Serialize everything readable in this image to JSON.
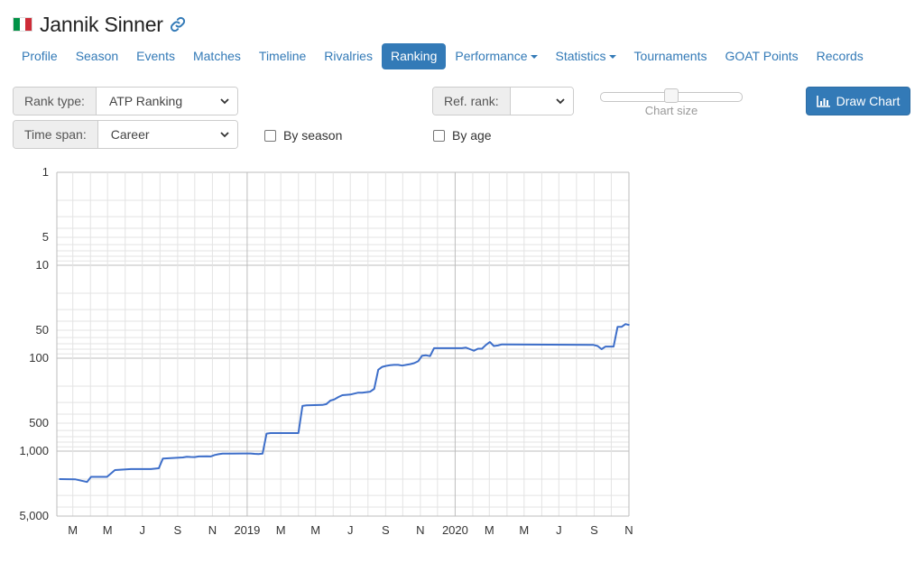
{
  "header": {
    "player_name": "Jannik Sinner",
    "flag_colors": [
      "#009246",
      "#ffffff",
      "#ce2b37"
    ],
    "link_icon": "link-icon"
  },
  "nav": {
    "items": [
      {
        "label": "Profile",
        "dropdown": false,
        "active": false
      },
      {
        "label": "Season",
        "dropdown": false,
        "active": false
      },
      {
        "label": "Events",
        "dropdown": false,
        "active": false
      },
      {
        "label": "Matches",
        "dropdown": false,
        "active": false
      },
      {
        "label": "Timeline",
        "dropdown": false,
        "active": false
      },
      {
        "label": "Rivalries",
        "dropdown": false,
        "active": false
      },
      {
        "label": "Ranking",
        "dropdown": false,
        "active": true
      },
      {
        "label": "Performance",
        "dropdown": true,
        "active": false
      },
      {
        "label": "Statistics",
        "dropdown": true,
        "active": false
      },
      {
        "label": "Tournaments",
        "dropdown": false,
        "active": false
      },
      {
        "label": "GOAT Points",
        "dropdown": false,
        "active": false
      },
      {
        "label": "Records",
        "dropdown": false,
        "active": false
      }
    ]
  },
  "controls": {
    "rank_type": {
      "label": "Rank type:",
      "value": "ATP Ranking"
    },
    "time_span": {
      "label": "Time span:",
      "value": "Career"
    },
    "ref_rank": {
      "label": "Ref. rank:",
      "value": ""
    },
    "by_season": {
      "label": "By season",
      "checked": false
    },
    "by_age": {
      "label": "By age",
      "checked": false
    },
    "chart_size": {
      "label": "Chart size",
      "value_fraction": 0.5
    },
    "draw_button": {
      "label": "Draw Chart",
      "icon": "bar-chart-icon"
    }
  },
  "colors": {
    "accent": "#337ab7",
    "series_line": "#3d6ec9",
    "grid_major": "#bdbdbd",
    "grid_minor": "#e3e3e3"
  },
  "chart_data": {
    "type": "line",
    "title": "",
    "xlabel": "",
    "ylabel": "",
    "y_scale": "log-reversed",
    "ylim": [
      1,
      5000
    ],
    "xlim": [
      "2018-02-01",
      "2020-11-01"
    ],
    "grid": true,
    "x_tick_labels": [
      "M",
      "M",
      "J",
      "S",
      "N",
      "2019",
      "M",
      "M",
      "J",
      "S",
      "N",
      "2020",
      "M",
      "M",
      "J",
      "S",
      "N"
    ],
    "y_tick_labels": [
      "1",
      "5",
      "10",
      "50",
      "100",
      "500",
      "1,000",
      "5,000"
    ],
    "y_tick_values": [
      1,
      5,
      10,
      50,
      100,
      500,
      1000,
      5000
    ],
    "series": [
      {
        "name": "",
        "points": [
          [
            "2018-02-05",
            2000
          ],
          [
            "2018-03-05",
            2010
          ],
          [
            "2018-03-26",
            2150
          ],
          [
            "2018-04-02",
            1890
          ],
          [
            "2018-04-30",
            1890
          ],
          [
            "2018-05-14",
            1600
          ],
          [
            "2018-06-11",
            1560
          ],
          [
            "2018-07-16",
            1560
          ],
          [
            "2018-07-30",
            1530
          ],
          [
            "2018-08-06",
            1200
          ],
          [
            "2018-09-10",
            1170
          ],
          [
            "2018-09-17",
            1150
          ],
          [
            "2018-09-24",
            1155
          ],
          [
            "2018-10-01",
            1160
          ],
          [
            "2018-10-08",
            1140
          ],
          [
            "2018-10-22",
            1135
          ],
          [
            "2018-10-29",
            1140
          ],
          [
            "2018-11-05",
            1100
          ],
          [
            "2018-11-12",
            1080
          ],
          [
            "2018-11-19",
            1065
          ],
          [
            "2018-12-24",
            1060
          ],
          [
            "2018-12-31",
            1060
          ],
          [
            "2019-01-07",
            1060
          ],
          [
            "2019-01-14",
            1070
          ],
          [
            "2019-01-21",
            1075
          ],
          [
            "2019-01-28",
            1065
          ],
          [
            "2019-02-04",
            648
          ],
          [
            "2019-02-11",
            640
          ],
          [
            "2019-03-25",
            640
          ],
          [
            "2019-04-01",
            640
          ],
          [
            "2019-04-08",
            326
          ],
          [
            "2019-04-15",
            322
          ],
          [
            "2019-05-13",
            318
          ],
          [
            "2019-05-20",
            312
          ],
          [
            "2019-05-27",
            286
          ],
          [
            "2019-06-03",
            278
          ],
          [
            "2019-06-10",
            262
          ],
          [
            "2019-06-17",
            250
          ],
          [
            "2019-07-01",
            246
          ],
          [
            "2019-07-15",
            235
          ],
          [
            "2019-07-22",
            235
          ],
          [
            "2019-08-05",
            229
          ],
          [
            "2019-08-12",
            214
          ],
          [
            "2019-08-19",
            133
          ],
          [
            "2019-08-26",
            124
          ],
          [
            "2019-09-02",
            121
          ],
          [
            "2019-09-09",
            119
          ],
          [
            "2019-09-16",
            118
          ],
          [
            "2019-09-23",
            118
          ],
          [
            "2019-09-30",
            120
          ],
          [
            "2019-10-07",
            118
          ],
          [
            "2019-10-14",
            116
          ],
          [
            "2019-10-21",
            113
          ],
          [
            "2019-10-28",
            108
          ],
          [
            "2019-11-04",
            94
          ],
          [
            "2019-11-11",
            93
          ],
          [
            "2019-11-18",
            95
          ],
          [
            "2019-11-25",
            78
          ],
          [
            "2019-12-02",
            78
          ],
          [
            "2019-12-16",
            78
          ],
          [
            "2020-01-13",
            78
          ],
          [
            "2020-01-20",
            77
          ],
          [
            "2020-01-27",
            80
          ],
          [
            "2020-02-03",
            83
          ],
          [
            "2020-02-10",
            79
          ],
          [
            "2020-02-17",
            79
          ],
          [
            "2020-02-24",
            72
          ],
          [
            "2020-03-02",
            67
          ],
          [
            "2020-03-09",
            74
          ],
          [
            "2020-03-16",
            73
          ],
          [
            "2020-03-23",
            71
          ],
          [
            "2020-08-31",
            72
          ],
          [
            "2020-09-07",
            74
          ],
          [
            "2020-09-14",
            80
          ],
          [
            "2020-09-21",
            75
          ],
          [
            "2020-09-28",
            75
          ],
          [
            "2020-10-05",
            75
          ],
          [
            "2020-10-12",
            46
          ],
          [
            "2020-10-19",
            46
          ],
          [
            "2020-10-26",
            43
          ],
          [
            "2020-11-02",
            44
          ]
        ]
      }
    ]
  }
}
